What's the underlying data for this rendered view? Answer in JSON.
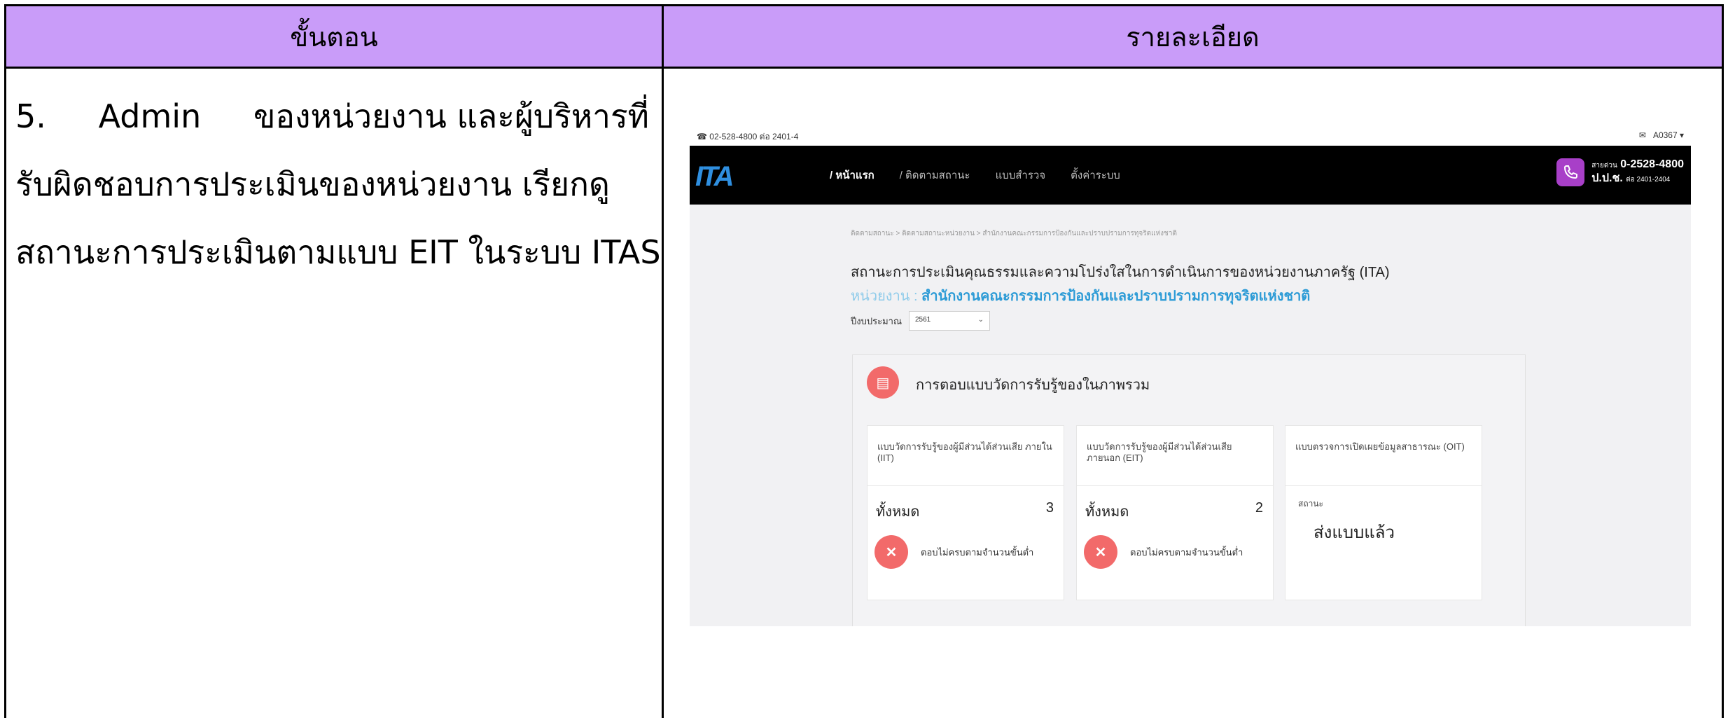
{
  "table": {
    "header_left": "ขั้นตอน",
    "header_right": "รายละเอียด"
  },
  "step": {
    "line1_num": "5.",
    "line1_word": "Admin",
    "line1_rest": "ของหน่วยงาน และผู้บริหารที่",
    "line2": "รับผิดชอบการประเมินของหน่วยงาน เรียกดู",
    "line3": "สถานะการประเมินตามแบบ EIT ในระบบ ITAS"
  },
  "screenshot": {
    "topbar": {
      "phone": "02-528-4800 ต่อ 2401-4",
      "account": "A0367 ▾"
    },
    "logo": "ITA",
    "nav": [
      "/ หน้าแรก",
      "/ ติดตามสถานะ",
      "แบบสำรวจ",
      "ตั้งค่าระบบ"
    ],
    "contact": {
      "label": "สายด่วน",
      "number": "0-2528-4800",
      "org": "ป.ป.ช.",
      "ext": "ต่อ 2401-2404"
    },
    "breadcrumb": "ติดตามสถานะ  >  ติดตามสถานะหน่วยงาน  >  สำนักงานคณะกรรมการป้องกันและปราบปรามการทุจริตแห่งชาติ",
    "title": "สถานะการประเมินคุณธรรมและความโปร่งใสในการดำเนินการของหน่วยงานภาครัฐ (ITA)",
    "unit_label": "หน่วยงาน :",
    "unit_value": "สำนักงานคณะกรรมการป้องกันและปราบปรามการทุจริตแห่งชาติ",
    "year_label": "ปีงบประมาณ",
    "year_value": "2561",
    "card_title": "การตอบแบบวัดการรับรู้ของในภาพรวม",
    "cards": [
      {
        "head": "แบบวัดการรับรู้ของผู้มีส่วนได้ส่วนเสีย ภายใน (IIT)",
        "total_label": "ทั้งหมด",
        "count": "3",
        "warning": "ตอบไม่ครบตามจำนวนขั้นต่ำ"
      },
      {
        "head": "แบบวัดการรับรู้ของผู้มีส่วนได้ส่วนเสีย ภายนอก (EIT)",
        "total_label": "ทั้งหมด",
        "count": "2",
        "warning": "ตอบไม่ครบตามจำนวนขั้นต่ำ"
      },
      {
        "head": "แบบตรวจการเปิดเผยข้อมูลสาธารณะ (OIT)",
        "status_label": "สถานะ",
        "status_value": "ส่งแบบแล้ว"
      }
    ]
  }
}
